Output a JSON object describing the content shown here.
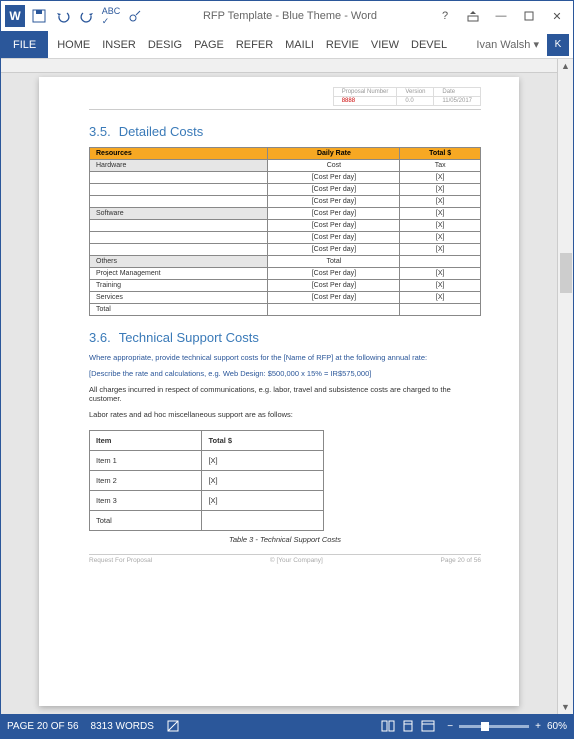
{
  "app": {
    "title": "RFP Template - Blue Theme - Word",
    "user": "Ivan Walsh"
  },
  "qat": {
    "save": "save-icon",
    "undo": "undo-icon",
    "redo": "redo-icon",
    "spell": "spell-icon",
    "touch": "touch-icon"
  },
  "ribbon": {
    "file": "FILE",
    "tabs": [
      "HOME",
      "INSER",
      "DESIG",
      "PAGE",
      "REFER",
      "MAILI",
      "REVIE",
      "VIEW",
      "DEVEL"
    ]
  },
  "header": {
    "labels": [
      "Proposal Number",
      "Version",
      "Date"
    ],
    "values": [
      "8888",
      "0.0",
      "11/05/2017"
    ]
  },
  "section35": {
    "num": "3.5.",
    "title": "Detailed Costs"
  },
  "cost_table": {
    "headers": [
      "Resources",
      "Daily Rate",
      "Total $"
    ],
    "rows": [
      {
        "sub": true,
        "c0": "Hardware",
        "c1": "Cost",
        "c2": "Tax"
      },
      {
        "c0": "",
        "c1": "[Cost Per day]",
        "c2": "[X]"
      },
      {
        "c0": "",
        "c1": "[Cost Per day]",
        "c2": "[X]"
      },
      {
        "c0": "",
        "c1": "[Cost Per day]",
        "c2": "[X]"
      },
      {
        "sub": true,
        "c0": "Software",
        "c1": "[Cost Per day]",
        "c2": "[X]"
      },
      {
        "c0": "",
        "c1": "[Cost Per day]",
        "c2": "[X]"
      },
      {
        "c0": "",
        "c1": "[Cost Per day]",
        "c2": "[X]"
      },
      {
        "c0": "",
        "c1": "[Cost Per day]",
        "c2": "[X]"
      },
      {
        "sub": true,
        "c0": "Others",
        "c1": "Total",
        "c2": ""
      },
      {
        "c0": "Project Management",
        "c1": "[Cost Per day]",
        "c2": "[X]"
      },
      {
        "c0": "Training",
        "c1": "[Cost Per day]",
        "c2": "[X]"
      },
      {
        "c0": "Services",
        "c1": "[Cost Per day]",
        "c2": "[X]"
      },
      {
        "c0": "Total",
        "c1": "",
        "c2": ""
      }
    ]
  },
  "section36": {
    "num": "3.6.",
    "title": "Technical Support Costs"
  },
  "notes": {
    "line1": "Where appropriate, provide technical support costs for the [Name of RFP] at the following annual rate:",
    "line2": "[Describe the rate and calculations, e.g. Web Design: $500,000 x 15% = IR$575,000]",
    "line3": "All charges incurred in respect of communications, e.g. labor, travel and subsistence costs are charged to the customer.",
    "line4": "Labor rates and ad hoc miscellaneous support are as follows:"
  },
  "support_table": {
    "headers": [
      "Item",
      "Total $"
    ],
    "rows": [
      {
        "c0": "Item 1",
        "c1": "[X]"
      },
      {
        "c0": "Item 2",
        "c1": "[X]"
      },
      {
        "c0": "Item 3",
        "c1": "[X]"
      },
      {
        "c0": "Total",
        "c1": ""
      }
    ],
    "caption": "Table 3 - Technical Support Costs"
  },
  "footer": {
    "left": "Request For Proposal",
    "center": "© [Your Company]",
    "right": "Page 20 of 56"
  },
  "status": {
    "page": "PAGE 20 OF 56",
    "words": "8313 WORDS",
    "zoom": "60%"
  }
}
